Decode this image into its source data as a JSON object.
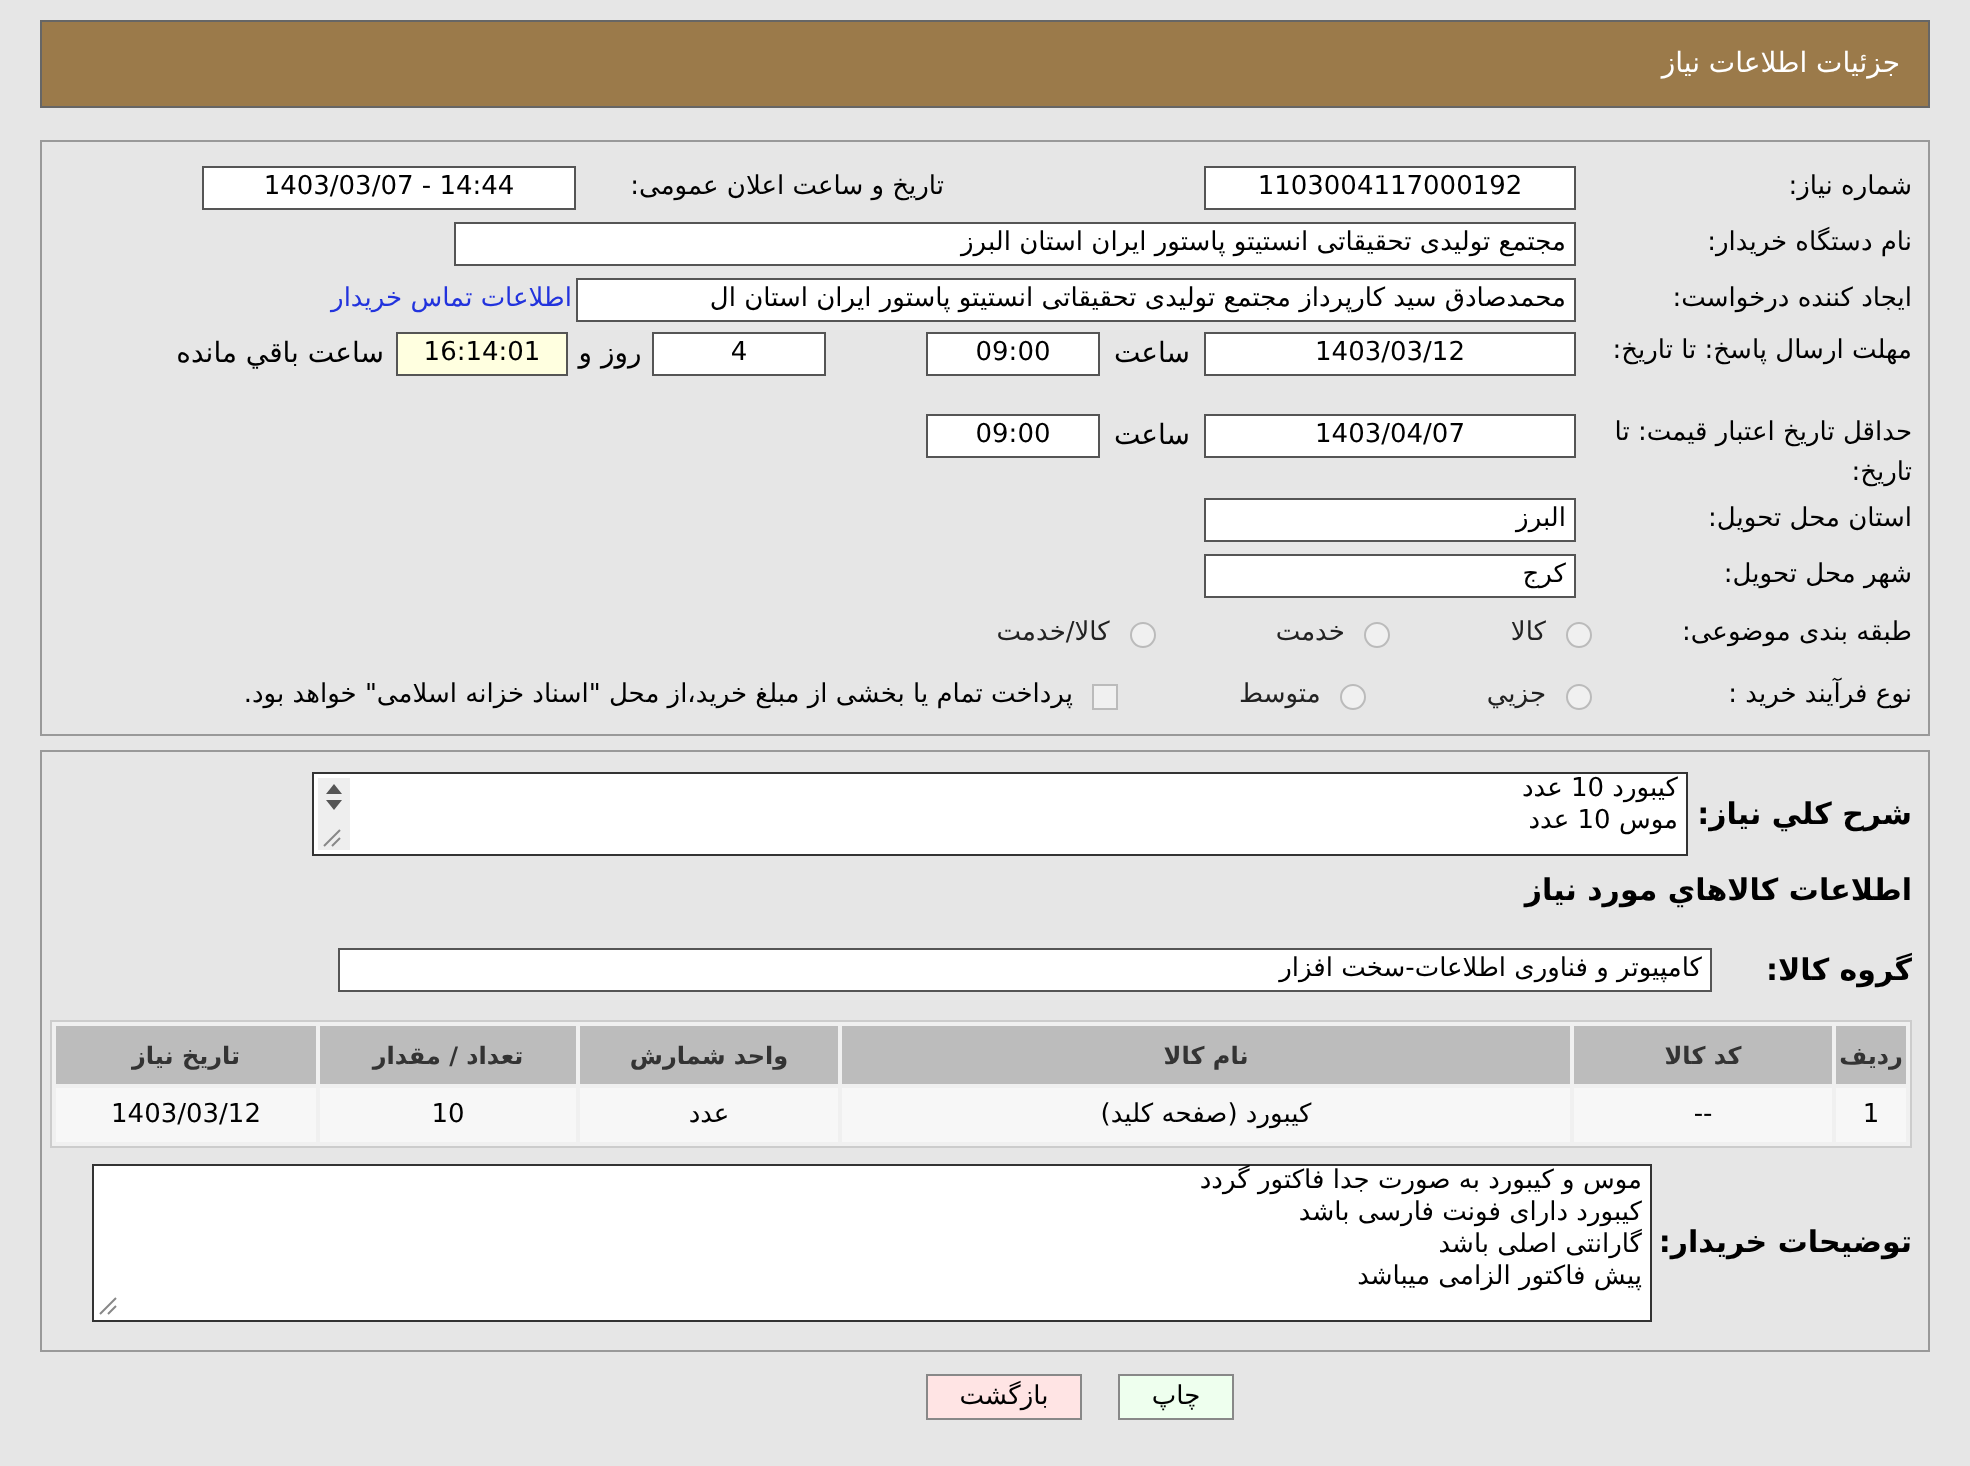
{
  "header": {
    "title": "جزئیات اطلاعات نیاز"
  },
  "need_number": {
    "label": "شماره نیاز:",
    "value": "1103004117000192"
  },
  "announce": {
    "label": "تاریخ و ساعت اعلان عمومی:",
    "value": "1403/03/07 - 14:44"
  },
  "buyer": {
    "label": "نام دستگاه خریدار:",
    "value": "مجتمع تولیدی تحقیقاتی انستیتو پاستور ایران استان البرز"
  },
  "creator": {
    "label": "ایجاد کننده درخواست:",
    "value": "محمدصادق سید کارپرداز مجتمع تولیدی تحقیقاتی انستیتو پاستور ایران استان ال",
    "link": "اطلاعات تماس خریدار"
  },
  "deadline": {
    "label": "مهلت ارسال پاسخ: تا تاریخ:",
    "date": "1403/03/12",
    "time_label": "ساعت",
    "time": "09:00",
    "days": "4",
    "days_label": "روز و",
    "remaining": "16:14:01",
    "remaining_label": "ساعت باقي مانده"
  },
  "validity": {
    "label": "حداقل تاریخ اعتبار قیمت: تا تاریخ:",
    "date": "1403/04/07",
    "time_label": "ساعت",
    "time": "09:00"
  },
  "province": {
    "label": "استان محل تحویل:",
    "value": "البرز"
  },
  "city": {
    "label": "شهر محل تحویل:",
    "value": "کرج"
  },
  "category": {
    "label": "طبقه بندی موضوعی:",
    "options": [
      {
        "label": "کالا",
        "selected": false
      },
      {
        "label": "خدمت",
        "selected": false
      },
      {
        "label": "کالا/خدمت",
        "selected": false
      }
    ]
  },
  "process": {
    "label": "نوع فرآیند خرید :",
    "options": [
      {
        "label": "جزيي",
        "selected": false
      },
      {
        "label": "متوسط",
        "selected": false
      }
    ],
    "treasury": {
      "checked": false,
      "text": "پرداخت تمام یا بخشی از مبلغ خرید،از محل \"اسناد خزانه اسلامی\" خواهد بود."
    }
  },
  "description": {
    "label": "شرح کلي نیاز:",
    "lines": [
      "کیبورد  10 عدد",
      "موس 10 عدد"
    ]
  },
  "goods_title": "اطلاعات کالاهاي مورد نیاز",
  "goods_group": {
    "label": "گروه کالا:",
    "value": "کامپیوتر و فناوری اطلاعات-سخت افزار"
  },
  "table": {
    "columns": [
      "ردیف",
      "کد کالا",
      "نام کالا",
      "واحد شمارش",
      "تعداد / مقدار",
      "تاریخ نیاز"
    ],
    "rows": [
      [
        "1",
        "--",
        "کیبورد (صفحه کلید)",
        "عدد",
        "10",
        "1403/03/12"
      ]
    ]
  },
  "buyer_notes": {
    "label": "توضیحات خریدار:",
    "lines": [
      "موس و کیبورد به صورت جدا فاکتور گردد",
      "کیبورد دارای فونت فارسی باشد",
      "گارانتی اصلی باشد",
      "پیش فاکتور الزامی میباشد"
    ]
  },
  "buttons": [
    {
      "label": "چاپ",
      "kind": "print"
    },
    {
      "label": "بازگشت",
      "kind": "back"
    }
  ]
}
